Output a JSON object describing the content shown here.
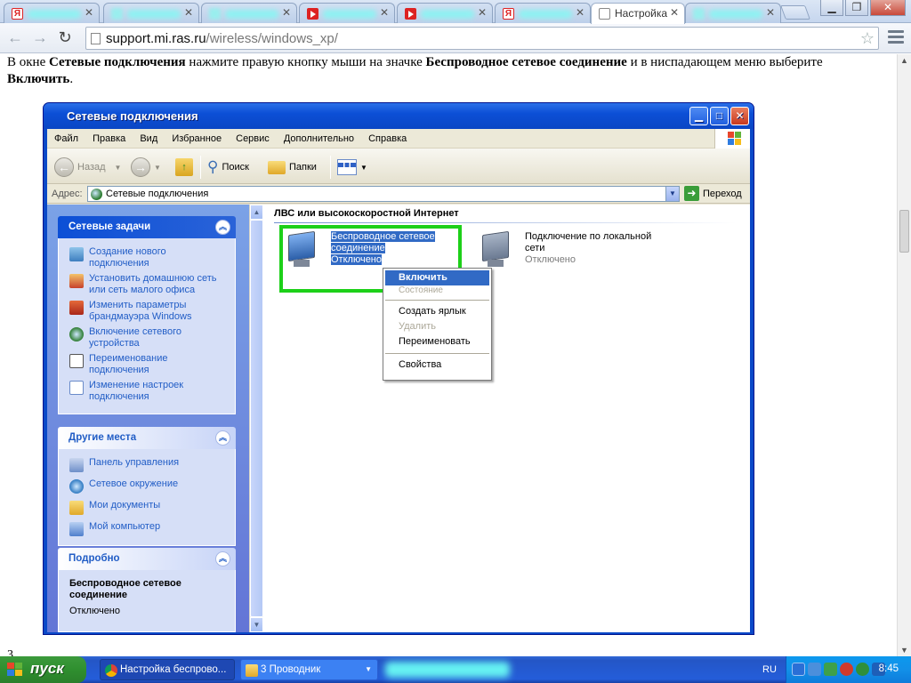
{
  "browser": {
    "tabs": [
      {
        "label": "",
        "favicon": "yandex-icon",
        "blurred": true
      },
      {
        "label": "",
        "favicon": "blurred-icon",
        "blurred": true
      },
      {
        "label": "",
        "favicon": "blurred-icon",
        "blurred": true
      },
      {
        "label": "",
        "favicon": "youtube-icon",
        "blurred": true
      },
      {
        "label": "",
        "favicon": "youtube-icon",
        "blurred": true
      },
      {
        "label": "",
        "favicon": "yandex-icon",
        "blurred": true
      },
      {
        "label": "Настройка",
        "favicon": "page-icon",
        "active": true
      },
      {
        "label": "",
        "favicon": "blurred-icon",
        "blurred": true
      }
    ],
    "url_host": "support.mi.ras.ru",
    "url_path": "/wireless/windows_xp/"
  },
  "page": {
    "instruction_parts": {
      "p1": "В окне ",
      "b1": "Сетевые подключения",
      "p2": " нажмите правую кнопку мыши на значке ",
      "b2": "Беспроводное сетевое соединение",
      "p3": " и в ниспадающем меню выберите ",
      "b3": "Включить",
      "p4": "."
    },
    "footer_fragment": "3."
  },
  "xp_window": {
    "title": "Сетевые подключения",
    "menu": [
      "Файл",
      "Правка",
      "Вид",
      "Избранное",
      "Сервис",
      "Дополнительно",
      "Справка"
    ],
    "toolbar": {
      "back": "Назад",
      "search": "Поиск",
      "folders": "Папки"
    },
    "address_label": "Адрес:",
    "address_value": "Сетевые подключения",
    "go_label": "Переход",
    "network_tasks": {
      "title": "Сетевые задачи",
      "items": [
        "Создание нового подключения",
        "Установить домашнюю сеть или сеть малого офиса",
        "Изменить параметры брандмауэра Windows",
        "Включение сетевого устройства",
        "Переименование подключения",
        "Изменение настроек подключения"
      ]
    },
    "other_places": {
      "title": "Другие места",
      "items": [
        "Панель управления",
        "Сетевое окружение",
        "Мои документы",
        "Мой компьютер"
      ]
    },
    "details": {
      "title": "Подробно",
      "name": "Беспроводное сетевое соединение",
      "status": "Отключено"
    },
    "group_title": "ЛВС или высокоскоростной Интернет",
    "connections": [
      {
        "name_line1": "Беспроводное сетевое",
        "name_line2": "соединение",
        "status": "Отключено"
      },
      {
        "name_line1": "Подключение по локальной",
        "name_line2": "сети",
        "status": "Отключено"
      }
    ],
    "context_menu": {
      "enable": "Включить",
      "status": "Состояние",
      "create_shortcut": "Создать ярлык",
      "delete": "Удалить",
      "rename": "Переименовать",
      "properties": "Свойства"
    }
  },
  "taskbar": {
    "start": "пуск",
    "tasks": [
      "Настройка беспрово...",
      "3 Проводник"
    ],
    "language": "RU",
    "clock": "8:45"
  }
}
